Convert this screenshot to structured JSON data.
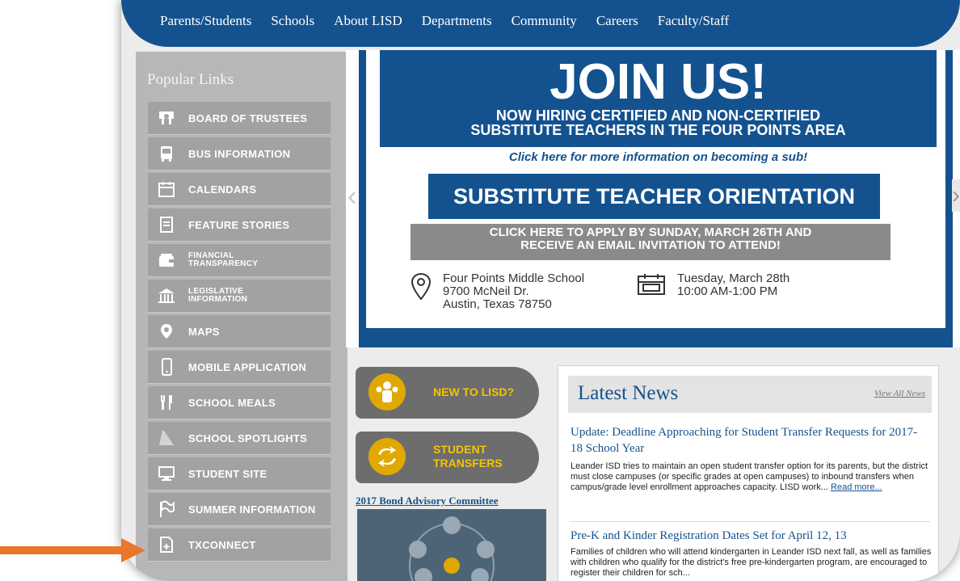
{
  "nav": {
    "items": [
      "Parents/Students",
      "Schools",
      "About LISD",
      "Departments",
      "Community",
      "Careers",
      "Faculty/Staff"
    ]
  },
  "sidebar": {
    "title": "Popular Links",
    "items": [
      {
        "label": "BOARD OF TRUSTEES",
        "icon": "trustees-icon"
      },
      {
        "label": "BUS INFORMATION",
        "icon": "bus-icon"
      },
      {
        "label": "CALENDARS",
        "icon": "calendar-icon"
      },
      {
        "label": "FEATURE STORIES",
        "icon": "feature-stories-icon"
      },
      {
        "label": "FINANCIAL\nTRANSPARENCY",
        "icon": "wallet-icon"
      },
      {
        "label": "LEGISLATIVE\nINFORMATION",
        "icon": "capitol-icon"
      },
      {
        "label": "MAPS",
        "icon": "map-pin-icon"
      },
      {
        "label": "MOBILE APPLICATION",
        "icon": "mobile-phone-icon"
      },
      {
        "label": "SCHOOL MEALS",
        "icon": "fork-knife-icon"
      },
      {
        "label": "SCHOOL SPOTLIGHTS",
        "icon": "spotlight-icon"
      },
      {
        "label": "STUDENT SITE",
        "icon": "monitor-icon"
      },
      {
        "label": "SUMMER INFORMATION",
        "icon": "flag-icon"
      },
      {
        "label": "TXCONNECT",
        "icon": "document-plus-icon"
      }
    ]
  },
  "banner": {
    "headline": "JOIN US!",
    "subhead_line1": "NOW HIRING CERTIFIED AND NON-CERTIFIED",
    "subhead_line2": "SUBSTITUTE TEACHERS IN THE FOUR POINTS AREA",
    "click_here": "Click here for more information on becoming a sub!",
    "orientation": "SUBSTITUTE TEACHER ORIENTATION",
    "apply_line1": "CLICK HERE TO APPLY BY SUNDAY, MARCH 26TH AND",
    "apply_line2": "RECEIVE AN EMAIL INVITATION TO ATTEND!",
    "location": "Four Points Middle School\n9700 McNeil Dr.\nAustin, Texas 78750",
    "datetime": "Tuesday, March 28th\n10:00 AM-1:00 PM"
  },
  "quicklinks": {
    "new_to_lisd": "NEW TO LISD?",
    "student_transfers": "STUDENT\nTRANSFERS",
    "bond_link": "2017 Bond Advisory Committee"
  },
  "news": {
    "title": "Latest News",
    "view_all": "View All News",
    "items": [
      {
        "title": "Update: Deadline Approaching for Student Transfer Requests for 2017-18 School Year",
        "body": "Leander ISD tries to maintain an open student transfer option for its parents, but the district must close campuses (or specific grades at open campuses) to inbound transfers when campus/grade level enrollment approaches capacity. LISD work...",
        "read_more": "Read more..."
      },
      {
        "title": "Pre-K and Kinder Registration Dates Set for April 12, 13",
        "body": "Families of children who will attend kindergarten in Leander ISD next fall, as well as families with children who qualify for the district's free pre-kindergarten program, are encouraged to register their children for sch..."
      }
    ]
  },
  "colors": {
    "brand_blue": "#14528f",
    "sidebar_gray": "#b7b7b7",
    "accent_yellow": "#f4c400",
    "annotation_orange": "#e8762b"
  }
}
